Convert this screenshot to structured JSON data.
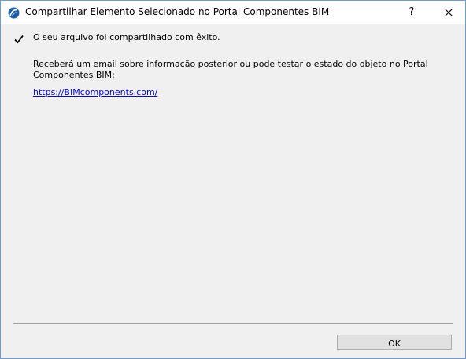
{
  "window": {
    "title": "Compartilhar Elemento Selecionado no Portal Componentes BIM",
    "help_label": "?",
    "app_icon": "archicad-logo-icon",
    "close_icon": "close-icon"
  },
  "content": {
    "status_icon": "checkmark-icon",
    "success_message": "O seu arquivo foi compartilhado com êxito.",
    "info_message": "Receberá um email sobre informação posterior ou pode testar o estado do objeto no Portal Componentes BIM:",
    "link_text": "https://BIMcomponents.com/"
  },
  "footer": {
    "ok_label": "OK"
  },
  "colors": {
    "link": "#0000ee",
    "window_border": "#6e9cd2",
    "dialog_background": "#f0f0f0"
  }
}
